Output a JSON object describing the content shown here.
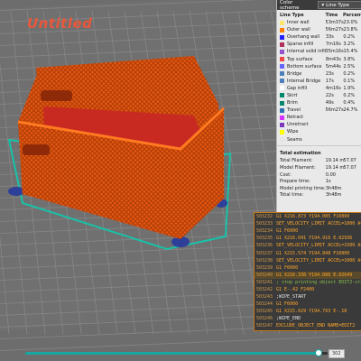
{
  "plate": {
    "label": "Untitled"
  },
  "legend": {
    "header_label": "Color scheme",
    "header_select": "Line Type",
    "columns": {
      "name": "Line Type",
      "time": "Time",
      "percent": "Percent"
    },
    "rows": [
      {
        "label": "Inner wall",
        "time": "53m37s",
        "pct": "23.0%",
        "color": "#ffe66b"
      },
      {
        "label": "Outer wall",
        "time": "56m27s",
        "pct": "23.8%",
        "color": "#ff7f00"
      },
      {
        "label": "Overhang wall",
        "time": "33s",
        "pct": "0.2%",
        "color": "#1f1fff"
      },
      {
        "label": "Sparse infill",
        "time": "7m16s",
        "pct": "3.2%",
        "color": "#b0305b"
      },
      {
        "label": "Internal solid infill",
        "time": "35m16s",
        "pct": "15.4%",
        "color": "#9654cc"
      },
      {
        "label": "Top surface",
        "time": "8m43s",
        "pct": "3.8%",
        "color": "#f04545"
      },
      {
        "label": "Bottom surface",
        "time": "5m44s",
        "pct": "2.5%",
        "color": "#6666ff"
      },
      {
        "label": "Bridge",
        "time": "23s",
        "pct": "0.2%",
        "color": "#4d80ba"
      },
      {
        "label": "Internal Bridge",
        "time": "17s",
        "pct": "0.1%",
        "color": "#4d80ba"
      },
      {
        "label": "Gap infill",
        "time": "4m16s",
        "pct": "1.9%",
        "color": "#ffffff"
      },
      {
        "label": "Skirt",
        "time": "22s",
        "pct": "0.2%",
        "color": "#00876e"
      },
      {
        "label": "Brim",
        "time": "49s",
        "pct": "0.4%",
        "color": "#00876e"
      },
      {
        "label": "Travel",
        "time": "56m27s",
        "pct": "24.7%",
        "color": "#2e70b4"
      },
      {
        "label": "Retract",
        "time": "",
        "pct": "",
        "color": "#d633ff"
      },
      {
        "label": "Unretract",
        "time": "",
        "pct": "",
        "color": "#7e36bf"
      },
      {
        "label": "Wipe",
        "time": "",
        "pct": "",
        "color": "#ffff00"
      },
      {
        "label": "Seams",
        "time": "",
        "pct": "",
        "color": "#e5e5e5"
      }
    ]
  },
  "estimation": {
    "title": "Total estimation",
    "rows": [
      {
        "k": "Total Filament:",
        "v": "19.14 m",
        "v2": "57.07"
      },
      {
        "k": "Model Filament:",
        "v": "19.14 m",
        "v2": "57.07"
      },
      {
        "k": "Cost:",
        "v": "0.00",
        "v2": ""
      },
      {
        "k": "Prepare time:",
        "v": "1s",
        "v2": ""
      },
      {
        "k": "Model printing time:",
        "v": "3h48m",
        "v2": ""
      },
      {
        "k": "Total time:",
        "v": "3h48m",
        "v2": ""
      }
    ]
  },
  "gcode": {
    "lines": [
      {
        "n": "503232",
        "t": "G1 X216.873 Y194.085 F10800",
        "kind": "cmd"
      },
      {
        "n": "503233",
        "t": "SET_VELOCITY_LIMIT ACCEL=1000 AC",
        "kind": "cmd"
      },
      {
        "n": "503234",
        "t": "G1 F6000",
        "kind": "cmd"
      },
      {
        "n": "503235",
        "t": "G1 X216.041 Y194.916 E.02936",
        "kind": "cmd"
      },
      {
        "n": "503236",
        "t": "SET_VELOCITY_LIMIT ACCEL=1500 AC",
        "kind": "cmd"
      },
      {
        "n": "503237",
        "t": "G1 X215.574 Y194.848 F10800",
        "kind": "cmd"
      },
      {
        "n": "503238",
        "t": "SET_VELOCITY_LIMIT ACCEL=1000 AC",
        "kind": "cmd"
      },
      {
        "n": "503239",
        "t": "G1 F6000",
        "kind": "cmd"
      },
      {
        "n": "503240",
        "t": "G1 X216.336 Y194.086 E.02649",
        "kind": "hl"
      },
      {
        "n": "503241",
        "t": "; stop printing object EDIT2-crate_so",
        "kind": "cmt"
      },
      {
        "n": "503242",
        "t": "G1 E-.42 F2400",
        "kind": "cmd"
      },
      {
        "n": "503243",
        "t": ";WIPE_START",
        "kind": "txt"
      },
      {
        "n": "503244",
        "t": "G1 F6000",
        "kind": "cmd"
      },
      {
        "n": "503245",
        "t": "G1 X215.629 Y194.793 E-.18",
        "kind": "cmd"
      },
      {
        "n": "503246",
        "t": ";WIPE_END",
        "kind": "txt"
      },
      {
        "n": "503247",
        "t": "EXCLUDE_OBJECT_END NAME=EDIT2",
        "kind": "cmd"
      }
    ]
  },
  "slider": {
    "value": "302",
    "progress": 0.97
  }
}
